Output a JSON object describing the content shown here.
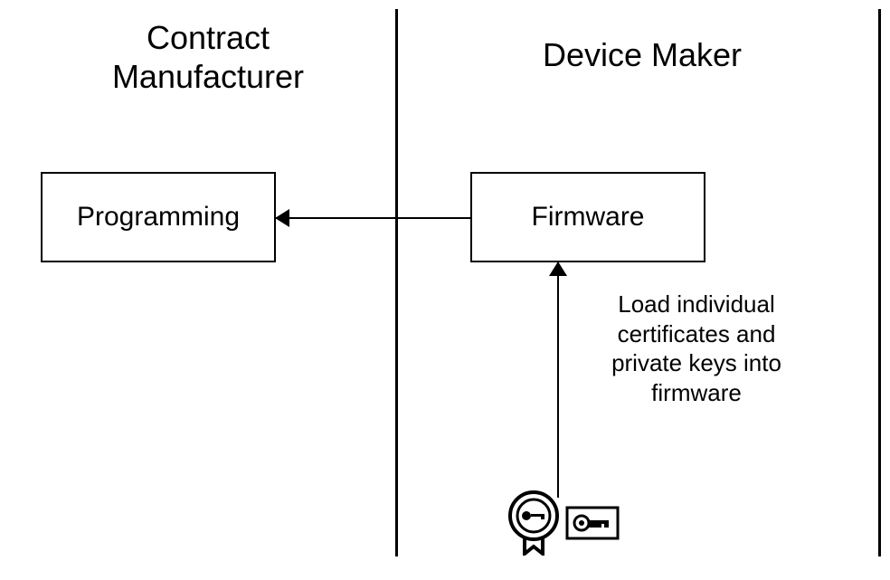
{
  "sections": {
    "left": {
      "title": "Contract Manufacturer"
    },
    "right": {
      "title": "Device Maker"
    }
  },
  "boxes": {
    "programming": {
      "label": "Programming"
    },
    "firmware": {
      "label": "Firmware"
    }
  },
  "annotation": {
    "text": "Load individual certificates and private keys into firmware"
  },
  "icons": {
    "certificate": "certificate-key-icon",
    "keycard": "key-card-icon"
  }
}
